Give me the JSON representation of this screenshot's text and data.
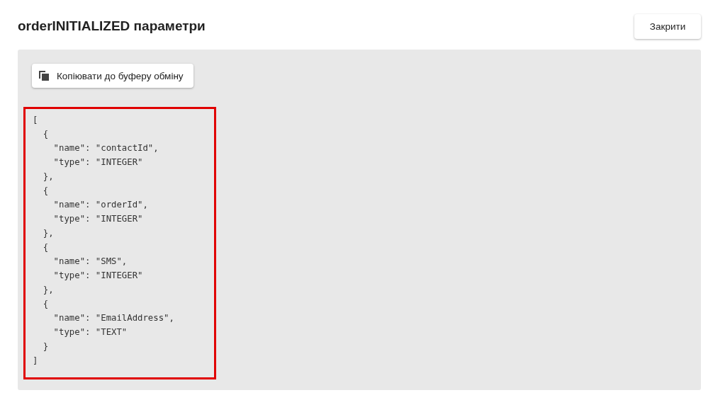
{
  "dialog": {
    "title": "orderINITIALIZED параметри",
    "close_button": "Закрити"
  },
  "panel": {
    "copy_button": "Копіювати до буферу обміну",
    "code_lines": [
      "[",
      "  {",
      "    \"name\": \"contactId\",",
      "    \"type\": \"INTEGER\"",
      "  },",
      "  {",
      "    \"name\": \"orderId\",",
      "    \"type\": \"INTEGER\"",
      "  },",
      "  {",
      "    \"name\": \"SMS\",",
      "    \"type\": \"INTEGER\"",
      "  },",
      "  {",
      "    \"name\": \"EmailAddress\",",
      "    \"type\": \"TEXT\"",
      "  }",
      "]"
    ]
  }
}
